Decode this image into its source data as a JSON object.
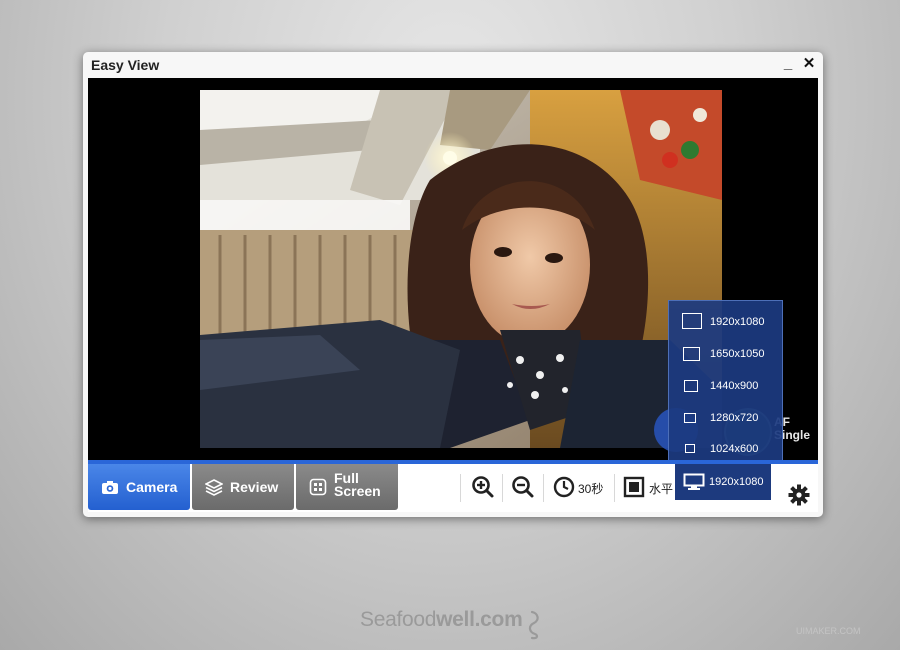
{
  "window": {
    "title": "Easy View",
    "minimize_glyph": "_",
    "close_glyph": "✕"
  },
  "viewer": {
    "af_line1": "AF",
    "af_line2": "Single"
  },
  "tabs": {
    "camera": "Camera",
    "review": "Review",
    "full_screen_line1": "Full",
    "full_screen_line2": "Screen"
  },
  "toolbar": {
    "timer_label": "30秒",
    "orientation_label": "水平",
    "resolution_label": "1920x1080"
  },
  "resolution_menu": {
    "options": [
      "1920x1080",
      "1650x1050",
      "1440x900",
      "1280x720",
      "1024x600"
    ]
  },
  "branding": {
    "name_light": "Seafood",
    "name_bold": "well.com",
    "watermark": "UIMAKER.COM"
  },
  "colors": {
    "accent": "#2a66d8",
    "menu_bg": "#1c3a80",
    "tab_inactive": "#777777"
  },
  "icons": [
    "camera-icon",
    "layers-icon",
    "fullscreen-icon",
    "zoom-in-icon",
    "zoom-out-icon",
    "clock-icon",
    "square-frame-icon",
    "monitor-icon",
    "gear-icon"
  ]
}
